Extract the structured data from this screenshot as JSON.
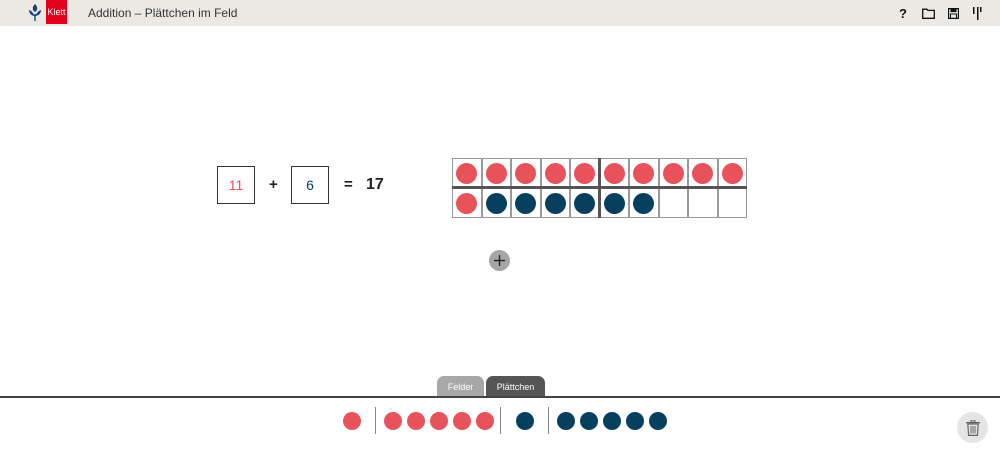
{
  "header": {
    "logo_text": "Klett",
    "title": "Addition – Plättchen im Feld",
    "help_label": "?"
  },
  "equation": {
    "addend1": "11",
    "plus": "+",
    "addend2": "6",
    "equals": "=",
    "result": "17"
  },
  "field": {
    "rows": 2,
    "cols": 10,
    "top_row": [
      "red",
      "red",
      "red",
      "red",
      "red",
      "red",
      "red",
      "red",
      "red",
      "red"
    ],
    "bottom_row": [
      "red",
      "blue",
      "blue",
      "blue",
      "blue",
      "blue",
      "blue",
      "",
      "",
      ""
    ]
  },
  "tabs": [
    {
      "label": "Felder",
      "active": false
    },
    {
      "label": "Plättchen",
      "active": true
    }
  ],
  "tray": {
    "groups": [
      {
        "color": "red",
        "count": 1
      },
      {
        "color": "red",
        "count": 5
      },
      {
        "color": "blue",
        "count": 1
      },
      {
        "color": "blue",
        "count": 5
      }
    ]
  },
  "colors": {
    "red": "#e8525a",
    "blue": "#07405f",
    "addend1_text": "#e8525a",
    "addend2_text": "#07405f",
    "header_bg": "#ebe9e3",
    "brand_red": "#e2001a"
  }
}
